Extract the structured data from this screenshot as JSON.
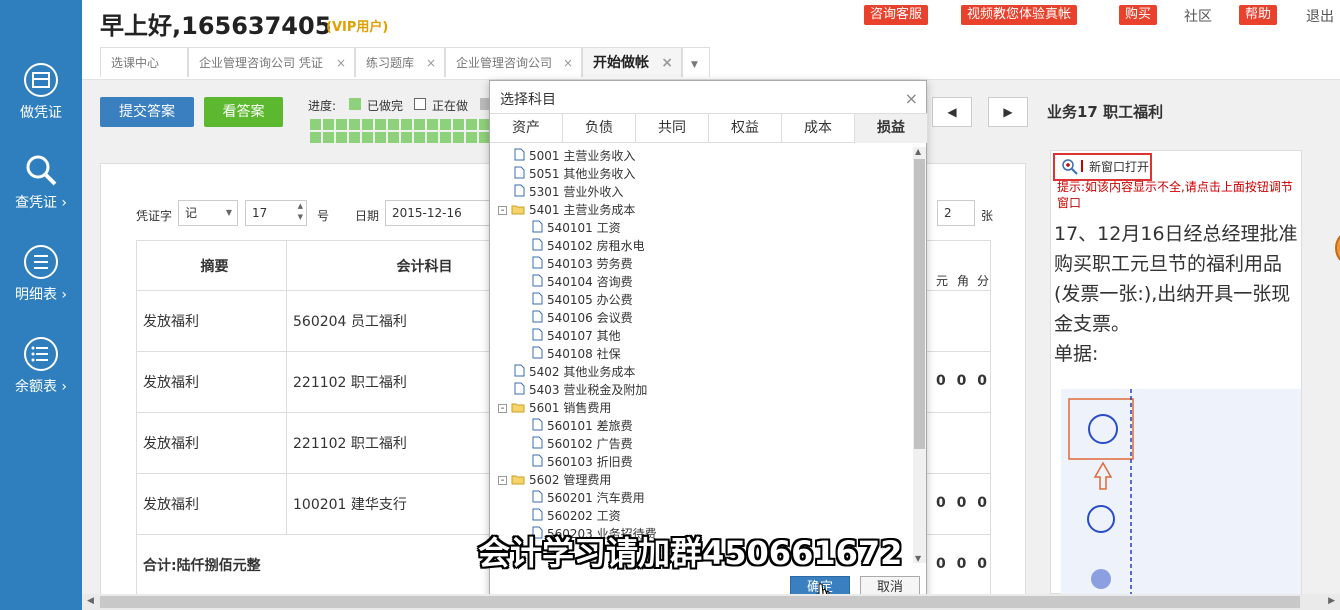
{
  "sidebar": {
    "items": [
      {
        "label": "做凭证",
        "icon": "voucher-icon"
      },
      {
        "label": "查凭证 ›",
        "icon": "search-icon"
      },
      {
        "label": "明细表 ›",
        "icon": "list-icon"
      },
      {
        "label": "余额表 ›",
        "icon": "balance-icon"
      }
    ]
  },
  "header": {
    "greeting": "早上好,165637405",
    "vip": "(VIP用户)",
    "buttons": [
      "咨询客服",
      "视频教您体验真帐",
      "购买",
      "帮助"
    ],
    "links": [
      "社区",
      "退出"
    ]
  },
  "tabs": [
    {
      "label": "选课中心"
    },
    {
      "label": "企业管理咨询公司 凭证"
    },
    {
      "label": "练习题库"
    },
    {
      "label": "企业管理咨询公司"
    },
    {
      "label": "开始做帐"
    }
  ],
  "toolbar": {
    "submit": "提交答案",
    "answer": "看答案",
    "progress_label": "进度:",
    "done": "已做完",
    "doing": "正在做",
    "prev": "◀",
    "next": "▶",
    "title": "业务17 职工福利"
  },
  "voucher": {
    "word_label": "凭证字",
    "word_value": "记",
    "number_value": "17",
    "number_unit": "号",
    "date_label": "日期",
    "date_value": "2015-12-16",
    "attach_value": "2",
    "attach_unit": "张",
    "col_summary": "摘要",
    "col_account": "会计科目",
    "digits_header": [
      "元",
      "角",
      "分"
    ],
    "rows": [
      {
        "summary": "发放福利",
        "account": "560204 员工福利",
        "digits": ""
      },
      {
        "summary": "发放福利",
        "account": "221102 职工福利",
        "digits": "0 0 0"
      },
      {
        "summary": "发放福利",
        "account": "221102 职工福利",
        "digits": ""
      },
      {
        "summary": "发放福利",
        "account": "100201 建华支行",
        "digits": "0 0 0"
      }
    ],
    "total": "合计:陆仟捌佰元整",
    "total_digits": "0 0 0"
  },
  "doc": {
    "new_window": "新窗口打开",
    "hint": "提示:如该内容显示不全,请点击上面按钮调节窗口",
    "question": "17、12月16日经总经理批准购买职工元旦节的福利用品(发票一张:),出纳开具一张现金支票。",
    "receipt_label": "单据:"
  },
  "dialog": {
    "title": "选择科目",
    "close": "×",
    "tabs": [
      "资产",
      "负债",
      "共同",
      "权益",
      "成本",
      "损益"
    ],
    "active_tab": "损益",
    "tree": [
      {
        "label": "5001 主营业务收入",
        "level": 1,
        "folder": false
      },
      {
        "label": "5051 其他业务收入",
        "level": 1,
        "folder": false
      },
      {
        "label": "5301 营业外收入",
        "level": 1,
        "folder": false
      },
      {
        "label": "5401 主营业务成本",
        "level": 0,
        "folder": true
      },
      {
        "label": "540101 工资",
        "level": 2,
        "folder": false
      },
      {
        "label": "540102 房租水电",
        "level": 2,
        "folder": false
      },
      {
        "label": "540103 劳务费",
        "level": 2,
        "folder": false
      },
      {
        "label": "540104 咨询费",
        "level": 2,
        "folder": false
      },
      {
        "label": "540105 办公费",
        "level": 2,
        "folder": false
      },
      {
        "label": "540106 会议费",
        "level": 2,
        "folder": false
      },
      {
        "label": "540107 其他",
        "level": 2,
        "folder": false
      },
      {
        "label": "540108 社保",
        "level": 2,
        "folder": false
      },
      {
        "label": "5402 其他业务成本",
        "level": 1,
        "folder": false
      },
      {
        "label": "5403 营业税金及附加",
        "level": 1,
        "folder": false
      },
      {
        "label": "5601 销售费用",
        "level": 0,
        "folder": true
      },
      {
        "label": "560101 差旅费",
        "level": 2,
        "folder": false
      },
      {
        "label": "560102 广告费",
        "level": 2,
        "folder": false
      },
      {
        "label": "560103 折旧费",
        "level": 2,
        "folder": false
      },
      {
        "label": "5602 管理费用",
        "level": 0,
        "folder": true
      },
      {
        "label": "560201 汽车费用",
        "level": 2,
        "folder": false
      },
      {
        "label": "560202 工资",
        "level": 2,
        "folder": false
      },
      {
        "label": "560203 业务招待费",
        "level": 2,
        "folder": false
      }
    ],
    "ok": "确定",
    "cancel": "取消"
  },
  "watermark": "会计学习请加群450661672",
  "colors": {
    "sidebar": "#2f7fbf",
    "accent_red": "#e8412c",
    "submit": "#3a7fc0",
    "answer": "#5cb82e",
    "progress_green": "#8dd17a"
  }
}
